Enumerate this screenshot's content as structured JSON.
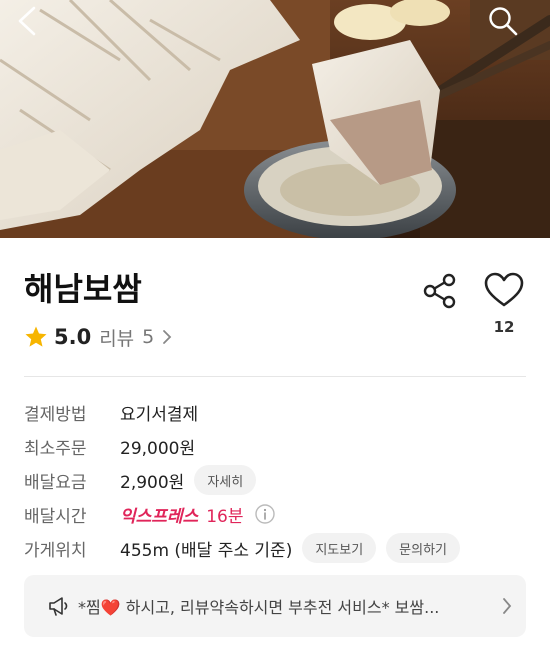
{
  "header": {
    "back_icon": "back-arrow-icon",
    "search_icon": "search-icon"
  },
  "store": {
    "name": "해남보쌈",
    "like_count": "12",
    "rating": "5.0",
    "review_label": "리뷰",
    "review_count": "5"
  },
  "info": {
    "payment": {
      "label": "결제방법",
      "value": "요기서결제"
    },
    "min_order": {
      "label": "최소주문",
      "value": "29,000원"
    },
    "delivery_fee": {
      "label": "배달요금",
      "value": "2,900원",
      "detail_button": "자세히"
    },
    "delivery_time": {
      "label": "배달시간",
      "express": "익스프레스",
      "value": "16분"
    },
    "location": {
      "label": "가게위치",
      "value": "455m (배달 주소 기준)",
      "map_button": "지도보기",
      "inquiry_button": "문의하기"
    }
  },
  "notice": {
    "text": "*찜❤️ 하시고, 리뷰약속하시면 부추전 서비스* 보쌈..."
  },
  "colors": {
    "express": "#e0255a",
    "star": "#f7b500"
  }
}
